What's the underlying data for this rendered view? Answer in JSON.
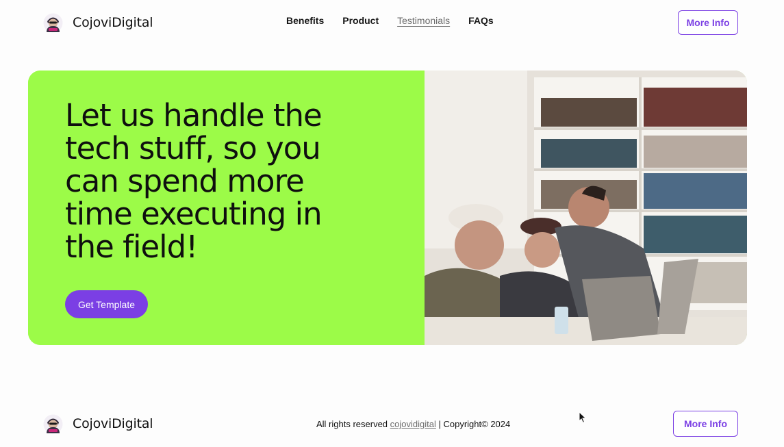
{
  "brand": {
    "name": "CojoviDigital",
    "logo_icon": "mascot-logo-icon"
  },
  "nav": {
    "items": [
      {
        "label": "Benefits",
        "active": false
      },
      {
        "label": "Product",
        "active": false
      },
      {
        "label": "Testimonials",
        "active": true
      },
      {
        "label": "FAQs",
        "active": false
      }
    ]
  },
  "header": {
    "cta_label": "More Info"
  },
  "hero": {
    "headline": "Let us handle the tech stuff, so you can spend more time executing in the field!",
    "cta_label": "Get Template",
    "image_icon": "team-laptop-photo",
    "accent_color": "#9cfb48"
  },
  "footer": {
    "rights_text": "All rights reserved",
    "link_text": "cojovidigital",
    "copyright_text": "| Copyright© 2024",
    "cta_label": "More Info"
  },
  "colors": {
    "primary": "#7b3fe4",
    "hero_green": "#9cfb48",
    "text": "#111111"
  }
}
